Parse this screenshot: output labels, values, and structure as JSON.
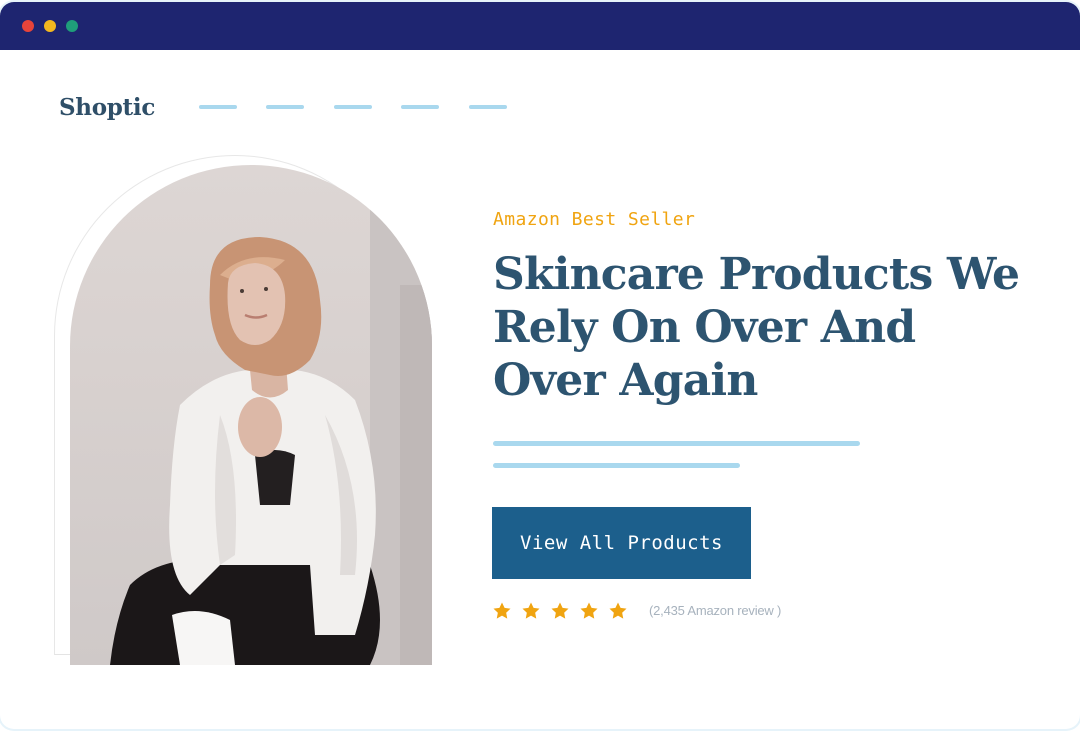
{
  "window": {
    "controls": [
      "close",
      "minimize",
      "maximize"
    ],
    "colors": {
      "titlebar": "#1e2570",
      "close": "#e8443a",
      "minimize": "#f3b81f",
      "maximize": "#1f9e7a"
    }
  },
  "header": {
    "logo": "Shoptic",
    "nav_items": [
      "",
      "",
      "",
      "",
      ""
    ]
  },
  "hero": {
    "image": "woman-in-white-blouse-portrait",
    "eyebrow": "Amazon Best Seller",
    "headline": "Skincare Products We Rely On Over And Over Again",
    "cta_label": "View All Products",
    "rating": 5,
    "rating_max": 5,
    "review_text": "(2,435 Amazon review )"
  },
  "colors": {
    "accent": "#f0a411",
    "heading": "#2d5470",
    "button": "#1c5f8c",
    "placeholder_line": "#a9d8ee"
  }
}
